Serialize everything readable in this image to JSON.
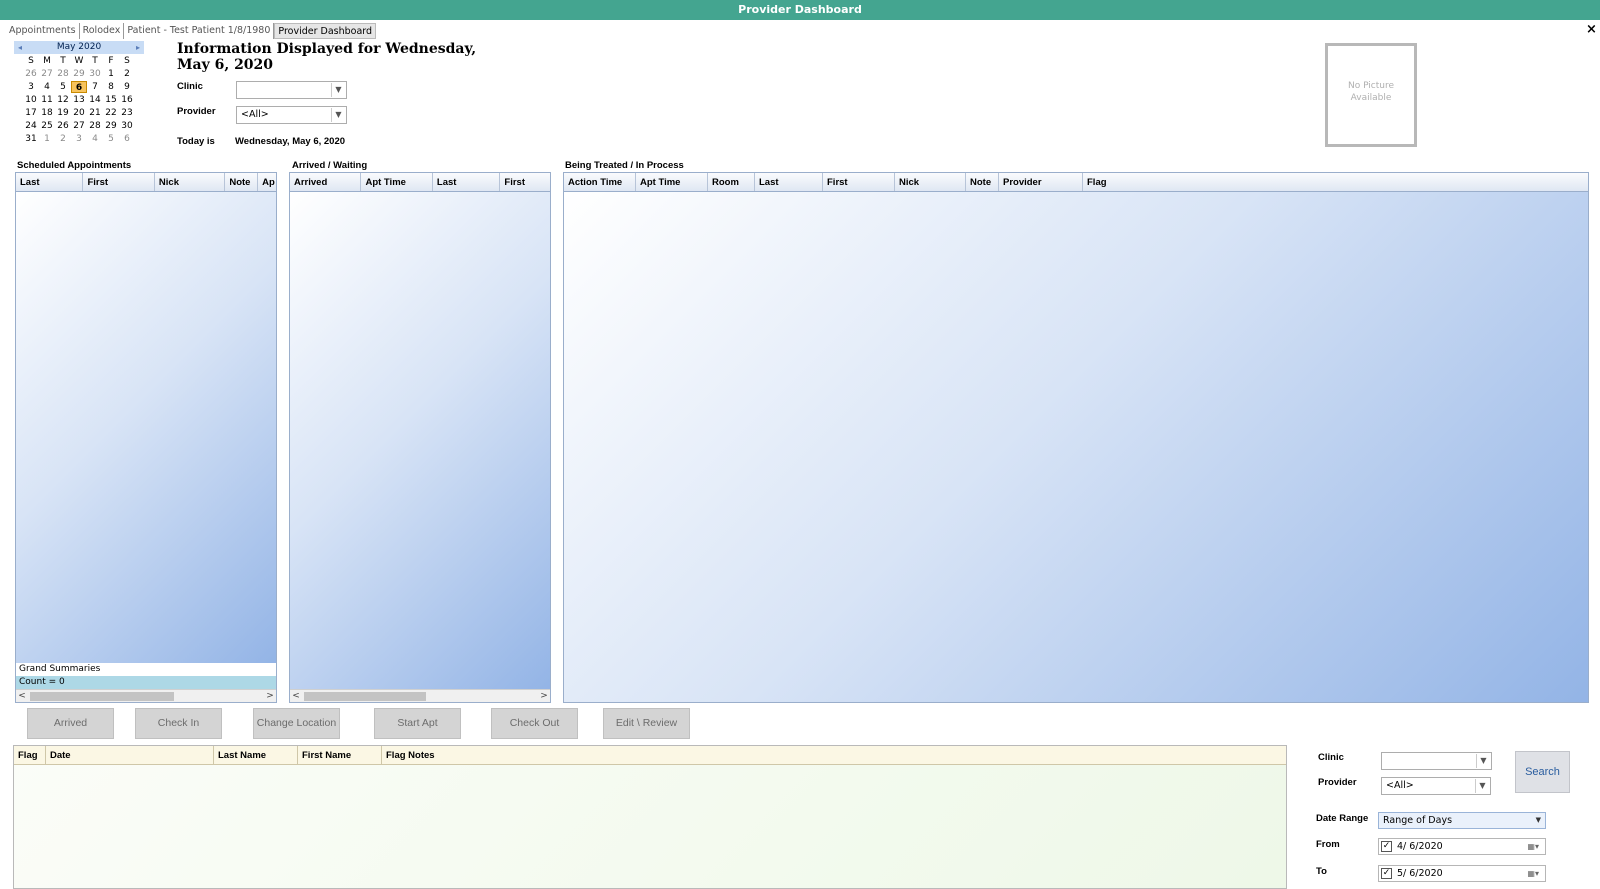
{
  "window": {
    "title": "Provider Dashboard",
    "close": "×"
  },
  "tabs": [
    "Appointments",
    "Rolodex",
    "Patient - Test Patient 1/8/1980",
    "Provider Dashboard"
  ],
  "calendar": {
    "month_label": "May 2020",
    "prev": "◂",
    "next": "▸",
    "days_of_week": [
      "S",
      "M",
      "T",
      "W",
      "T",
      "F",
      "S"
    ],
    "weeks": [
      [
        "26",
        "27",
        "28",
        "29",
        "30",
        "1",
        "2"
      ],
      [
        "3",
        "4",
        "5",
        "6",
        "7",
        "8",
        "9"
      ],
      [
        "10",
        "11",
        "12",
        "13",
        "14",
        "15",
        "16"
      ],
      [
        "17",
        "18",
        "19",
        "20",
        "21",
        "22",
        "23"
      ],
      [
        "24",
        "25",
        "26",
        "27",
        "28",
        "29",
        "30"
      ],
      [
        "31",
        "1",
        "2",
        "3",
        "4",
        "5",
        "6"
      ]
    ],
    "selected_day": "6"
  },
  "info": {
    "title": "Information Displayed for Wednesday, May 6, 2020",
    "clinic_label": "Clinic",
    "clinic_value": "",
    "provider_label": "Provider",
    "provider_value": "<All>",
    "today_label": "Today is",
    "today_value": "Wednesday, May 6, 2020"
  },
  "no_picture": "No Picture Available",
  "scheduled": {
    "title": "Scheduled Appointments",
    "columns": [
      "Last",
      "First",
      "Nick",
      "Note",
      "Ap"
    ],
    "grand_summaries": "Grand Summaries",
    "count": "Count = 0"
  },
  "arrived": {
    "title": "Arrived / Waiting",
    "columns": [
      "Arrived",
      "Apt Time",
      "Last",
      "First"
    ]
  },
  "treated": {
    "title": "Being Treated / In Process",
    "columns": [
      "Action Time",
      "Apt Time",
      "Room",
      "Last",
      "First",
      "Nick",
      "Note",
      "Provider",
      "Flag"
    ]
  },
  "actions": {
    "arrived": "Arrived",
    "check_in": "Check In",
    "change_location": "Change Location",
    "start_apt": "Start Apt",
    "check_out": "Check Out",
    "edit_review": "Edit \\ Review"
  },
  "flags": {
    "columns": [
      "Flag",
      "Date",
      "Last Name",
      "First Name",
      "Flag Notes"
    ]
  },
  "filters": {
    "clinic_label": "Clinic",
    "clinic_value": "",
    "provider_label": "Provider",
    "provider_value": "<All>",
    "search_label": "Search",
    "date_range_label": "Date Range",
    "date_range_value": "Range of Days",
    "from_label": "From",
    "from_value": "4/ 6/2020",
    "to_label": "To",
    "to_value": "5/ 6/2020"
  },
  "colors": {
    "titlebar": "#44a590",
    "selected_day": "#f7c35c",
    "grid_gradient_end": "#93b4e6",
    "search_text": "#2a5d9f"
  },
  "icons": {
    "dropdown": "chevron-down-icon",
    "calendar_prev": "chevron-left-icon",
    "calendar_next": "chevron-right-icon",
    "close": "close-icon",
    "checkbox": "checkbox-checked-icon"
  }
}
